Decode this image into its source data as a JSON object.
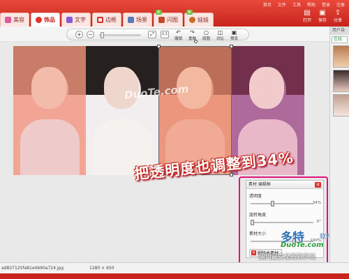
{
  "top_menu": [
    "首页",
    "文件",
    "工具",
    "帮助",
    "登录",
    "注册"
  ],
  "tabs": [
    {
      "label": "美容",
      "active": false,
      "icon": "beauty-icon",
      "color": "#e05a9a"
    },
    {
      "label": "饰品",
      "active": true,
      "icon": "accessory-icon",
      "color": "#e0342a"
    },
    {
      "label": "文字",
      "active": false,
      "icon": "text-icon",
      "color": "#8a5ad8"
    },
    {
      "label": "边框",
      "active": false,
      "icon": "frame-icon",
      "color": "#d0302a"
    },
    {
      "label": "场景",
      "active": false,
      "icon": "scene-icon",
      "color": "#5a7ab8"
    },
    {
      "label": "闪图",
      "active": false,
      "icon": "flash-icon",
      "color": "#c04a2a",
      "badge": "新"
    },
    {
      "label": "娃娃",
      "active": false,
      "icon": "doll-icon",
      "color": "#d06a2a",
      "badge": "新"
    }
  ],
  "toolbar_right": [
    {
      "label": "打开",
      "icon": "open-icon"
    },
    {
      "label": "保存",
      "icon": "save-icon"
    },
    {
      "label": "分享",
      "icon": "share-icon"
    }
  ],
  "zoom": {
    "in": "+",
    "out": "−",
    "fit": "⤢",
    "actual": "1:1"
  },
  "actions": [
    {
      "label": "撤销",
      "icon": "undo-icon",
      "glyph": "↶"
    },
    {
      "label": "重做",
      "icon": "redo-icon",
      "glyph": "↷"
    },
    {
      "label": "原图",
      "icon": "original-icon",
      "glyph": "○"
    },
    {
      "label": "对比",
      "icon": "compare-icon",
      "glyph": "◫"
    },
    {
      "label": "预览",
      "icon": "preview-icon",
      "glyph": "▣"
    }
  ],
  "canvas": {
    "watermark": "DuoTe.com",
    "caption": "把透明度也调整到34%",
    "panels": [
      {
        "tint": "#f3a08e",
        "hair": "#c7735c",
        "skin": "#f4b8a4",
        "shirt": "#f0c8c8"
      },
      {
        "tint": "#f2eef0",
        "hair": "#26211f",
        "skin": "#efd6cd",
        "shirt": "#f5f1ef"
      },
      {
        "tint": "#ee8f76",
        "hair": "#b8654c",
        "skin": "#f3b59a",
        "shirt": "#f1a58f"
      },
      {
        "tint": "#a86095",
        "hair": "#6a2140",
        "skin": "#f2c9c9",
        "shirt": "#e9b4c6"
      }
    ]
  },
  "dialog": {
    "title": "素材 编辑框",
    "close": "✕",
    "opacity_label": "透明度",
    "opacity_value": "34%",
    "opacity": 0.34,
    "rotation_label": "旋转角度",
    "rotation_value": "0°",
    "size_label": "素材大小",
    "size_value": "100%",
    "delete_label": "删除本素材"
  },
  "brand": {
    "name": "多特",
    "sub": "软件站",
    "url": "DuoTe.com",
    "slogan": "国内最安全的软件站"
  },
  "sidebar": {
    "header": "用户自",
    "tab": "在线"
  },
  "status": {
    "filename": "ad837125fa81e4b90a724.jpg",
    "dimensions": "1280 × 650"
  }
}
